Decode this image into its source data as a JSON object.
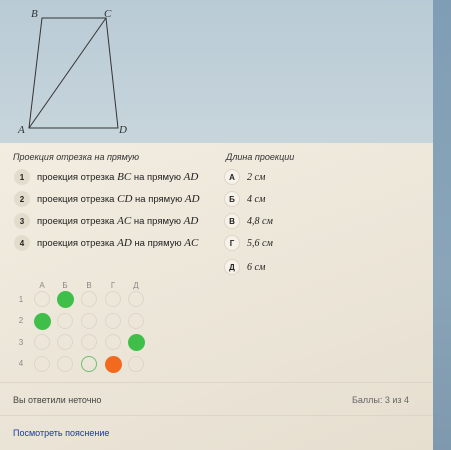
{
  "figure": {
    "vertices": {
      "A": "A",
      "B": "B",
      "C": "C",
      "D": "D"
    }
  },
  "task": {
    "left_header": "Проекция отрезка на прямую",
    "right_header": "Длина проекции",
    "rows": [
      {
        "num": "1",
        "text": "проекция отрезка",
        "seg": "BC",
        "mid": "на прямую",
        "line": "AD"
      },
      {
        "num": "2",
        "text": "проекция отрезка",
        "seg": "CD",
        "mid": "на прямую",
        "line": "AD"
      },
      {
        "num": "3",
        "text": "проекция отрезка",
        "seg": "AC",
        "mid": "на прямую",
        "line": "AD"
      },
      {
        "num": "4",
        "text": "проекция отрезка",
        "seg": "AD",
        "mid": "на прямую",
        "line": "AC"
      }
    ],
    "answers": [
      {
        "letter": "А",
        "value": "2 см"
      },
      {
        "letter": "Б",
        "value": "4 см"
      },
      {
        "letter": "В",
        "value": "4,8 см"
      },
      {
        "letter": "Г",
        "value": "5,6 см"
      },
      {
        "letter": "Д",
        "value": "6 см"
      }
    ]
  },
  "grid": {
    "columns": [
      "А",
      "Б",
      "В",
      "Г",
      "Д"
    ],
    "rows": [
      "1",
      "2",
      "3",
      "4"
    ],
    "marks": [
      {
        "row": 1,
        "col": 2,
        "state": "correct"
      },
      {
        "row": 2,
        "col": 1,
        "state": "correct"
      },
      {
        "row": 3,
        "col": 5,
        "state": "correct"
      },
      {
        "row": 4,
        "col": 4,
        "state": "wrong"
      },
      {
        "row": 4,
        "col": 3,
        "state": "expected"
      }
    ],
    "colors": {
      "correct": "#3fbf4a",
      "wrong": "#f26a1e",
      "expected": "#6fbf6f"
    }
  },
  "footer": {
    "result_text": "Вы ответили неточно",
    "score_text": "Баллы: 3 из 4",
    "explain_link": "Посмотреть пояснение"
  }
}
